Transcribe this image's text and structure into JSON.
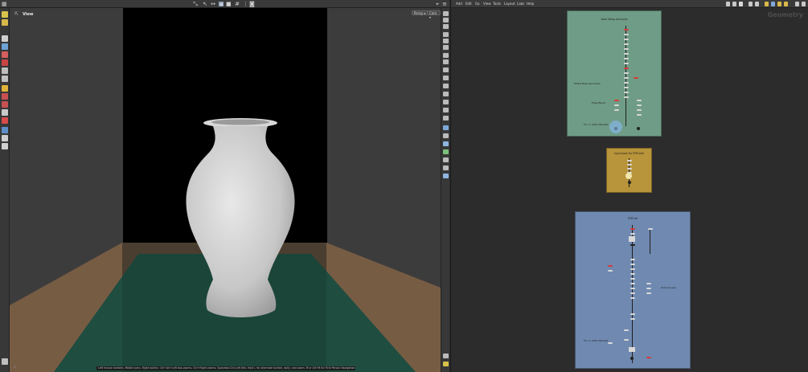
{
  "viewer": {
    "title": "View",
    "camera_button": "Persp ▾",
    "cam_button": "Cam ▾",
    "status_text": "Left mouse tumbles. Middle pans. Right dollies. Ctrl+Alt+Left box-zooms. Ctrl+Right zooms. Spacebar-Ctrl-Left tilts. Hold L for alternate tumble, dolly, and zoom. M or Alt+M for First Person Navigation."
  },
  "network": {
    "menu": [
      "Add",
      "Edit",
      "Go",
      "View",
      "Tools",
      "Layout",
      "Labs",
      "Help"
    ],
    "context_label": "Geometry",
    "boxes": [
      {
        "title": "Vase Setup and prep",
        "color": "#6f9c86",
        "notes": [
          "Model Base geometry",
          "Edge Bevel",
          "For vc stitch Blanket"
        ]
      },
      {
        "title": "Input base for FEM side",
        "color": "#b8943a",
        "notes": []
      },
      {
        "title": "FEM Vol",
        "color": "#6f89b0",
        "notes": [
          "Post process",
          "For vc stitch Blanket"
        ]
      }
    ]
  },
  "colors": {
    "backdrop": "#000000",
    "floor": "#7a6046",
    "floor_center": "#1e4a3e",
    "vase": "#d4d4d4"
  }
}
